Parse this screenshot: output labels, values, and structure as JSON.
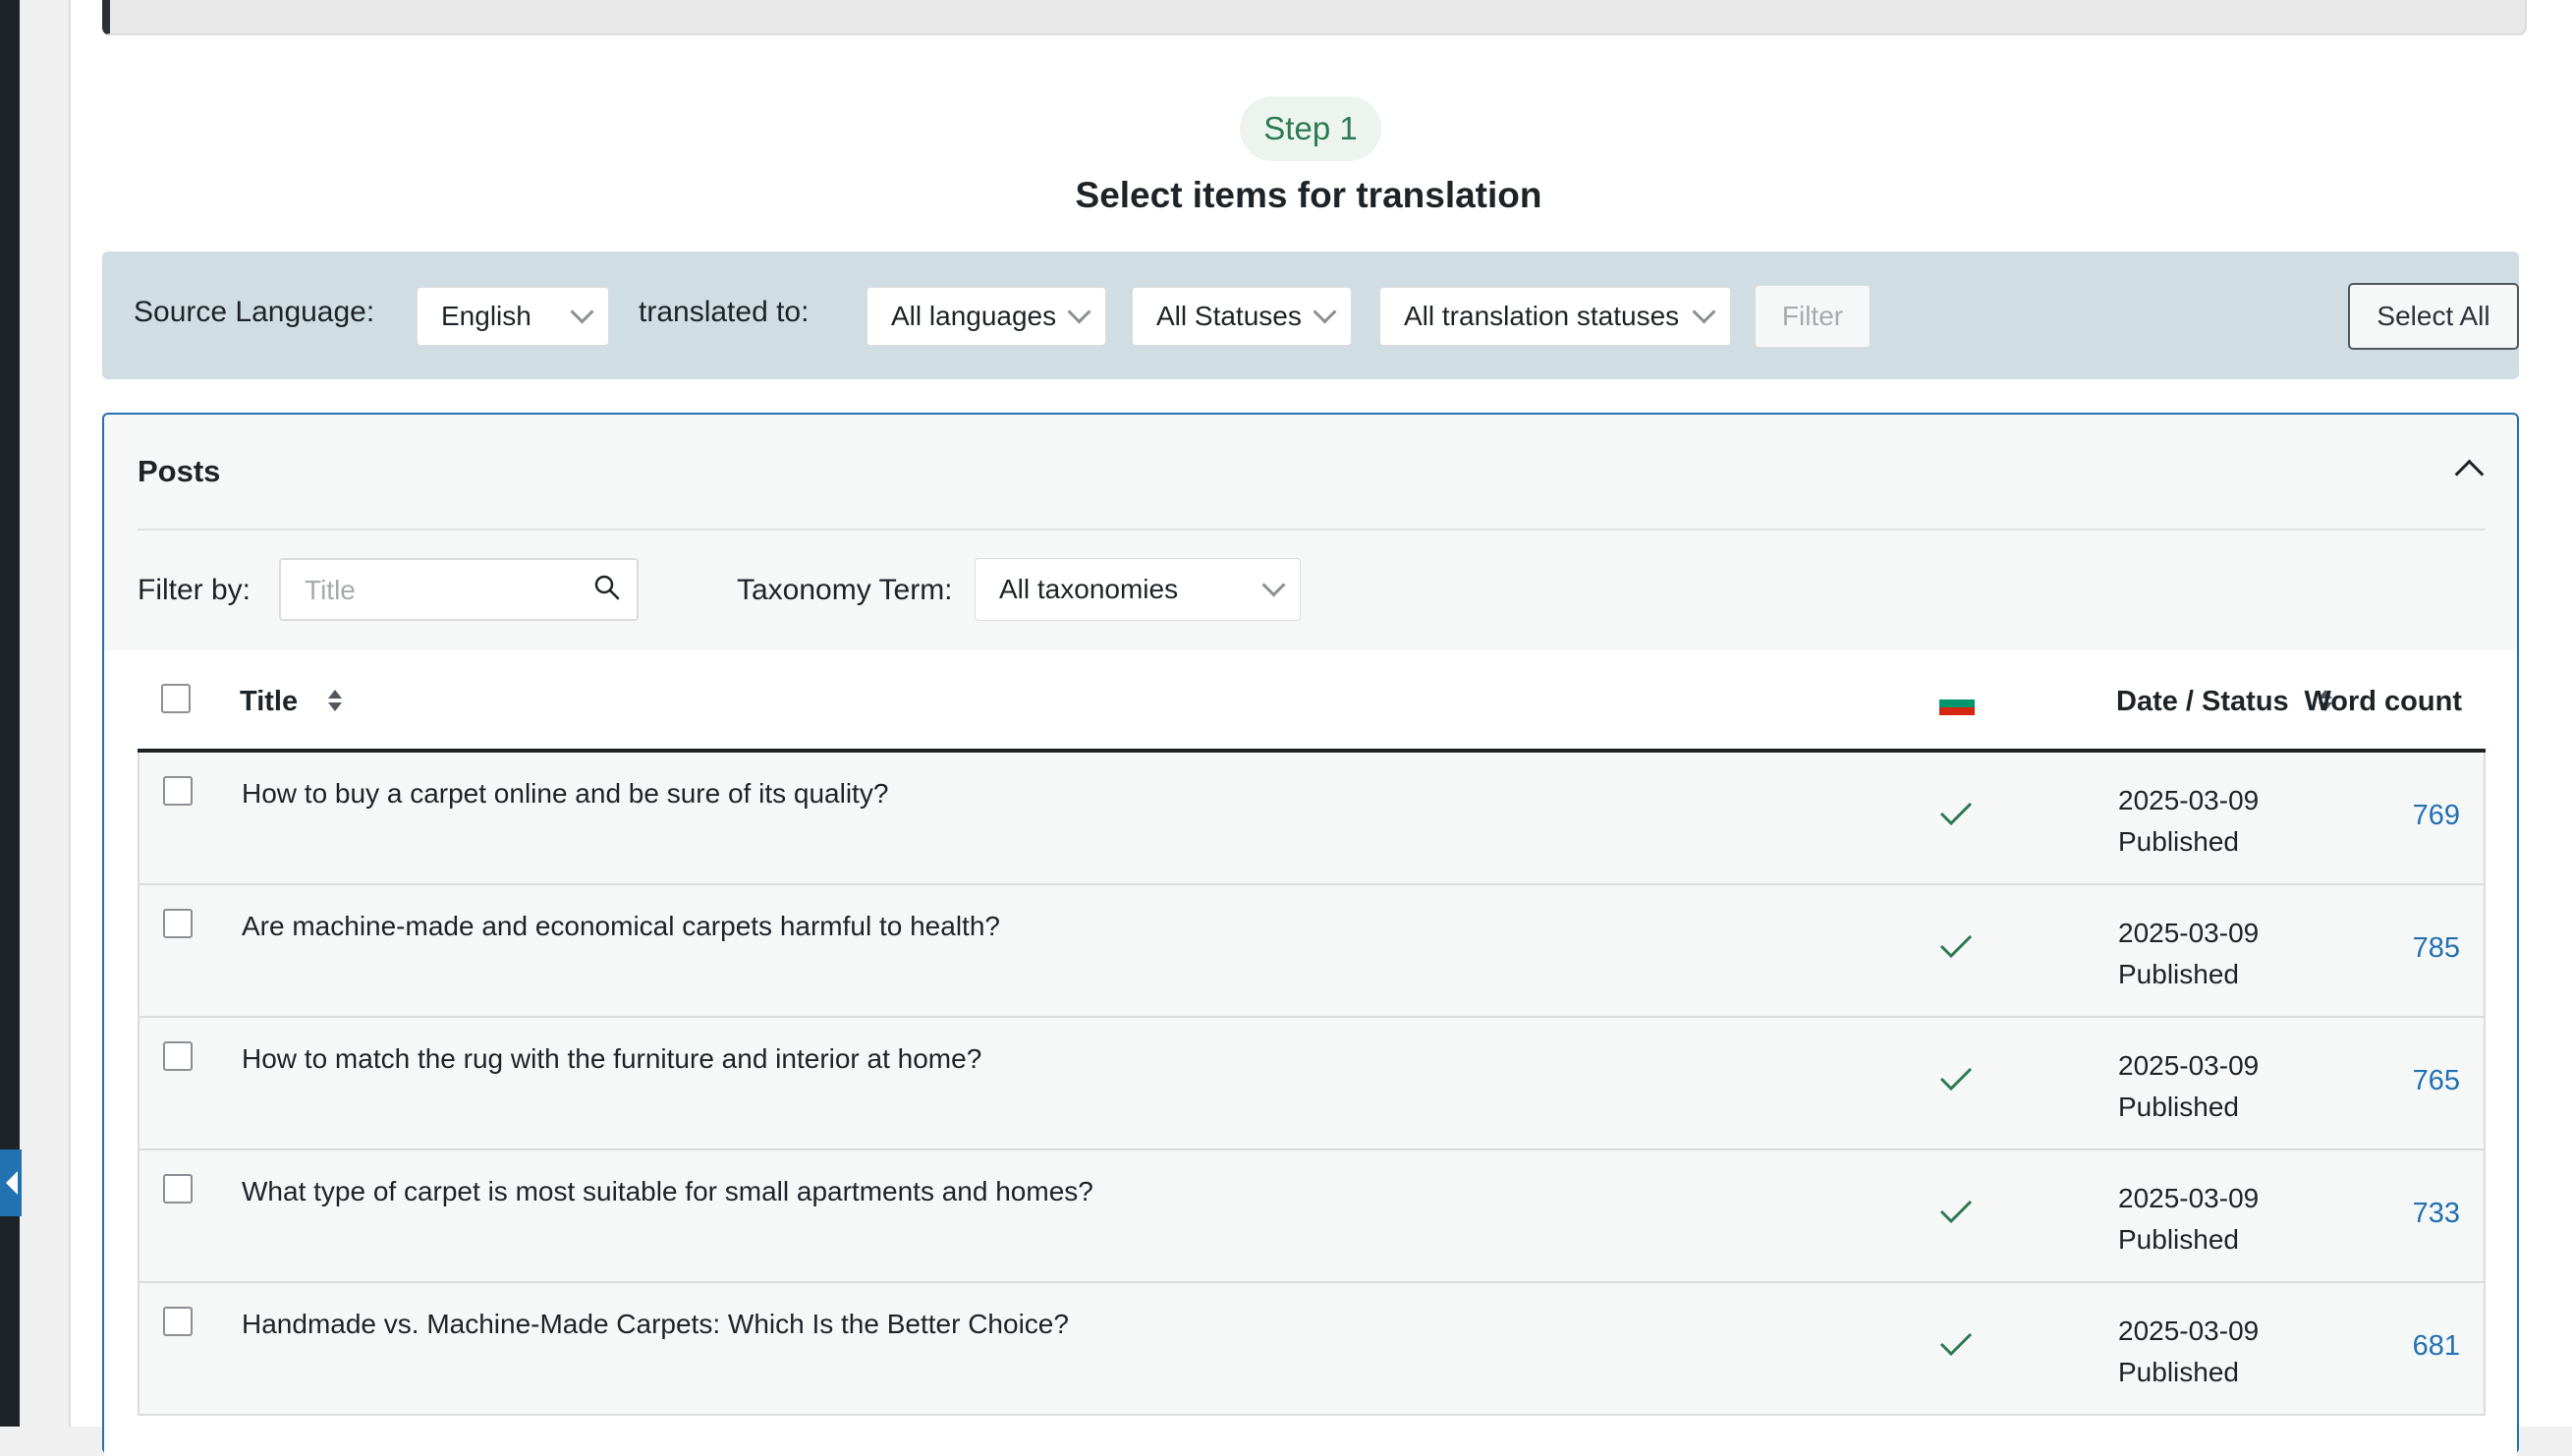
{
  "step": {
    "label": "Step 1",
    "title": "Select items for translation"
  },
  "filter_bar": {
    "source_language_label": "Source Language:",
    "source_language_value": "English",
    "translated_to_label": "translated to:",
    "languages_value": "All languages",
    "statuses_value": "All Statuses",
    "translation_statuses_value": "All translation statuses",
    "filter_button": "Filter",
    "select_all_button": "Select All"
  },
  "posts_panel": {
    "title": "Posts",
    "filter_by_label": "Filter by:",
    "title_search_placeholder": "Title",
    "taxonomy_label": "Taxonomy Term:",
    "taxonomy_value": "All taxonomies"
  },
  "table": {
    "headers": {
      "title": "Title",
      "date_status": "Date / Status",
      "word_count": "Word count"
    },
    "language_flag": "bulgarian-flag-icon",
    "rows": [
      {
        "title": "How to buy a carpet online and be sure of its quality?",
        "date": "2025-03-09",
        "status": "Published",
        "word_count": "769"
      },
      {
        "title": "Are machine-made and economical carpets harmful to health?",
        "date": "2025-03-09",
        "status": "Published",
        "word_count": "785"
      },
      {
        "title": "How to match the rug with the furniture and interior at home?",
        "date": "2025-03-09",
        "status": "Published",
        "word_count": "765"
      },
      {
        "title": "What type of carpet is most suitable for small apartments and homes?",
        "date": "2025-03-09",
        "status": "Published",
        "word_count": "733"
      },
      {
        "title": "Handmade vs. Machine-Made Carpets: Which Is the Better Choice?",
        "date": "2025-03-09",
        "status": "Published",
        "word_count": "681"
      }
    ]
  },
  "colors": {
    "accent": "#2271b1",
    "step_green": "#2a7a52",
    "filter_bar_bg": "#d0dde3",
    "check_green": "#2a7a52"
  }
}
